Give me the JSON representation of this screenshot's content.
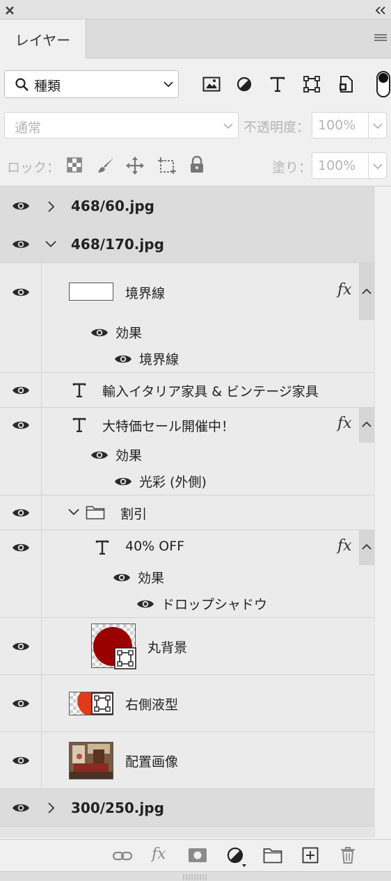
{
  "panel": {
    "tab_label": "レイヤー"
  },
  "filter": {
    "kind_label": "種類"
  },
  "blend": {
    "mode": "通常",
    "opacity_label": "不透明度：",
    "opacity_value": "100%"
  },
  "lock": {
    "label": "ロック：",
    "fill_label": "塗り：",
    "fill_value": "100%"
  },
  "layers": {
    "g1": "468/60.jpg",
    "g2": "468/170.jpg",
    "border_layer": "境界線",
    "effects_label": "効果",
    "border_effect": "境界線",
    "text1": "輸入イタリア家具 & ビンテージ家具",
    "text2": "大特価セール開催中！",
    "glow_effect": "光彩 (外側)",
    "folder": "割引",
    "text3": "40% OFF",
    "shadow_effect": "ドロップシャドウ",
    "circle_bg": "丸背景",
    "right_shape": "右側液型",
    "placed_image": "配置画像",
    "g3": "300/250.jpg"
  },
  "fx_label": "fx",
  "colors": {
    "accent_red": "#9b0000",
    "orange_red": "#e03a1a"
  }
}
